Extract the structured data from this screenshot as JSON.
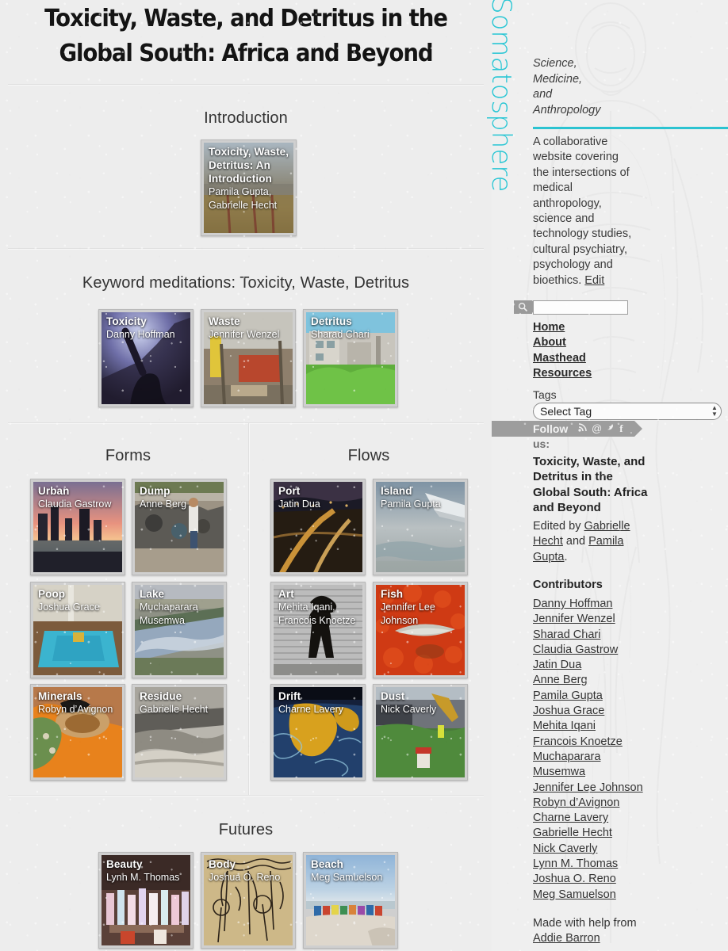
{
  "site": {
    "brand": "Somatosphere",
    "tagline": "Science,\nMedicine,\nand\nAnthropology",
    "description": "A collaborative website covering the intersections of medical anthropology, science and technology studies, cultural psychiatry, psychology and bioethics.",
    "edit_label": "Edit",
    "accent_color": "#2cc3d1"
  },
  "header": {
    "title": "Toxicity, Waste, and Detritus in the Global South: Africa and Beyond"
  },
  "search": {
    "placeholder": "",
    "value": "",
    "icon": "search-icon"
  },
  "nav": {
    "items": [
      {
        "label": "Home"
      },
      {
        "label": "About"
      },
      {
        "label": "Masthead"
      },
      {
        "label": "Resources"
      }
    ]
  },
  "tags": {
    "label": "Tags",
    "selected": "Select Tag",
    "options": [
      "Select Tag"
    ]
  },
  "follow": {
    "label": "Follow",
    "label2": "us:",
    "icons": [
      {
        "name": "rss-icon",
        "glyph": "◔"
      },
      {
        "name": "email-icon",
        "glyph": "@"
      },
      {
        "name": "twitter-icon",
        "glyph": "ᵗ"
      },
      {
        "name": "facebook-icon",
        "glyph": "f"
      }
    ]
  },
  "issue": {
    "title": "Toxicity, Waste, and Detritus in the Global South: Africa and Beyond",
    "edited_prefix": "Edited by ",
    "editor_1": "Gabrielle Hecht",
    "edited_join": " and ",
    "editor_2": "Pamila Gupta",
    "edited_suffix": "."
  },
  "contributors": {
    "heading": "Contributors",
    "names": [
      "Danny Hoffman",
      "Jennifer Wenzel",
      "Sharad Chari",
      "Claudia Gastrow",
      "Jatin Dua",
      "Anne Berg",
      "Pamila Gupta",
      "Joshua Grace",
      "Mehita Iqani",
      "Francois Knoetze",
      "Muchaparara",
      "Musemwa",
      "Jennifer Lee Johnson",
      "Robyn d’Avignon",
      "Charne Lavery",
      "Gabrielle Hecht",
      "Nick Caverly",
      "Lynn M. Thomas",
      "Joshua O. Reno",
      "Meg Samuelson"
    ]
  },
  "credits": {
    "prefix": "Made with help from",
    "person": "Addie Barron"
  },
  "sections": {
    "introduction": {
      "heading": "Introduction",
      "items": [
        {
          "title": "Toxicity, Waste, Detritus: An Introduction",
          "author": "Pamila Gupta, Gabrielle Hecht"
        }
      ]
    },
    "keywords": {
      "heading": "Keyword meditations: Toxicity, Waste, Detritus",
      "items": [
        {
          "title": "Toxicity",
          "author": "Danny Hoffman"
        },
        {
          "title": "Waste",
          "author": "Jennifer Wenzel"
        },
        {
          "title": "Detritus",
          "author": "Sharad Chari"
        }
      ]
    },
    "forms": {
      "heading": "Forms",
      "items": [
        {
          "title": "Urban",
          "author": "Claudia Gastrow"
        },
        {
          "title": "Dump",
          "author": "Anne Berg"
        },
        {
          "title": "Poop",
          "author": "Joshua Grace"
        },
        {
          "title": "Lake",
          "author": "Muchaparara Musemwa"
        },
        {
          "title": "Minerals",
          "author": "Robyn d’Avignon"
        },
        {
          "title": "Residue",
          "author": "Gabrielle Hecht"
        }
      ]
    },
    "flows": {
      "heading": "Flows",
      "items": [
        {
          "title": "Port",
          "author": "Jatin Dua"
        },
        {
          "title": "Island",
          "author": "Pamila Gupta"
        },
        {
          "title": "Art",
          "author": "Mehita Iqani, Francois Knoetze"
        },
        {
          "title": "Fish",
          "author": "Jennifer Lee Johnson"
        },
        {
          "title": "Drift",
          "author": "Charne Lavery"
        },
        {
          "title": "Dust",
          "author": "Nick Caverly"
        }
      ]
    },
    "futures": {
      "heading": "Futures",
      "items": [
        {
          "title": "Beauty",
          "author": "Lynn M. Thomas"
        },
        {
          "title": "Body",
          "author": "Joshua O. Reno"
        },
        {
          "title": "Beach",
          "author": "Meg Samuelson"
        }
      ]
    }
  }
}
